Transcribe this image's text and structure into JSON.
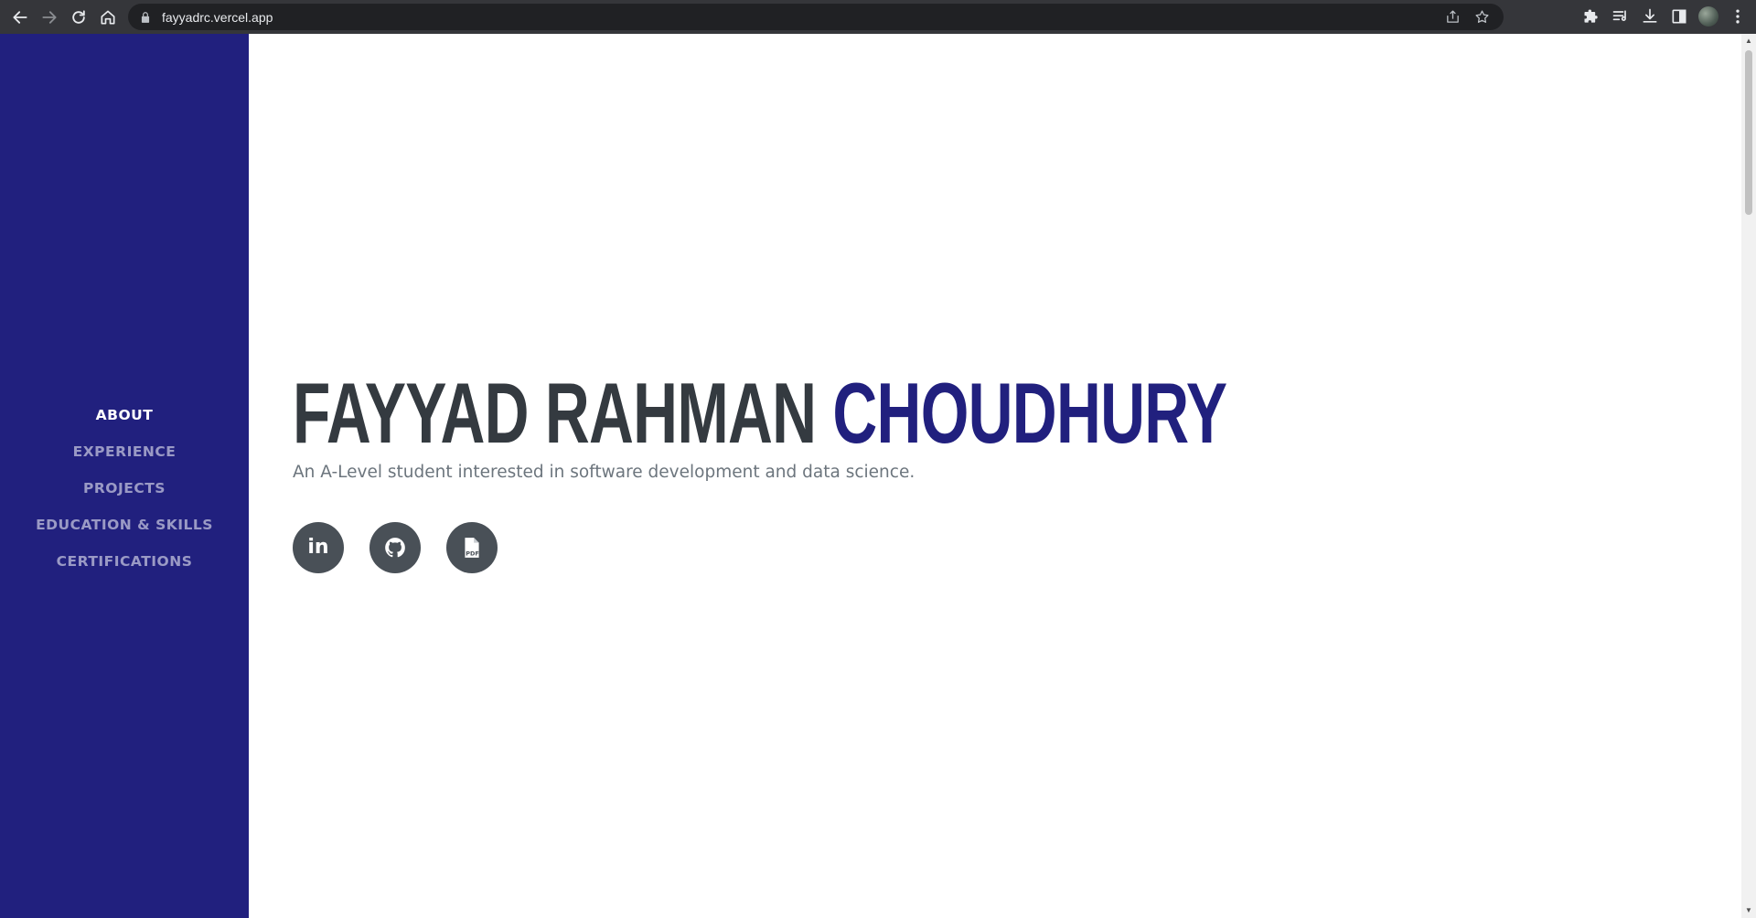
{
  "browser": {
    "url": "fayyadrc.vercel.app",
    "nav_icons": [
      "back-arrow-icon",
      "forward-arrow-icon",
      "reload-icon",
      "home-icon"
    ],
    "omnibox_icons": [
      "share-icon",
      "bookmark-star-icon"
    ],
    "toolbar_icons": [
      "extensions-icon",
      "reading-list-icon",
      "download-icon",
      "side-panel-icon",
      "profile-avatar",
      "menu-kebab-icon"
    ]
  },
  "colors": {
    "sidebar_bg": "#21207e",
    "accent": "#21207e",
    "heading": "#343a40",
    "subtitle": "#6c757d",
    "social_bg": "#495057"
  },
  "sidebar": {
    "items": [
      {
        "label": "ABOUT",
        "active": true
      },
      {
        "label": "EXPERIENCE",
        "active": false
      },
      {
        "label": "PROJECTS",
        "active": false
      },
      {
        "label": "EDUCATION & SKILLS",
        "active": false
      },
      {
        "label": "CERTIFICATIONS",
        "active": false
      }
    ]
  },
  "hero": {
    "first_name": "FAYYAD RAHMAN",
    "last_name": "CHOUDHURY",
    "subtitle": "An A-Level student interested in software development and data science.",
    "socials": [
      {
        "icon": "linkedin-icon",
        "label": "in"
      },
      {
        "icon": "github-icon"
      },
      {
        "icon": "pdf-file-icon",
        "label": "PDF"
      }
    ]
  }
}
